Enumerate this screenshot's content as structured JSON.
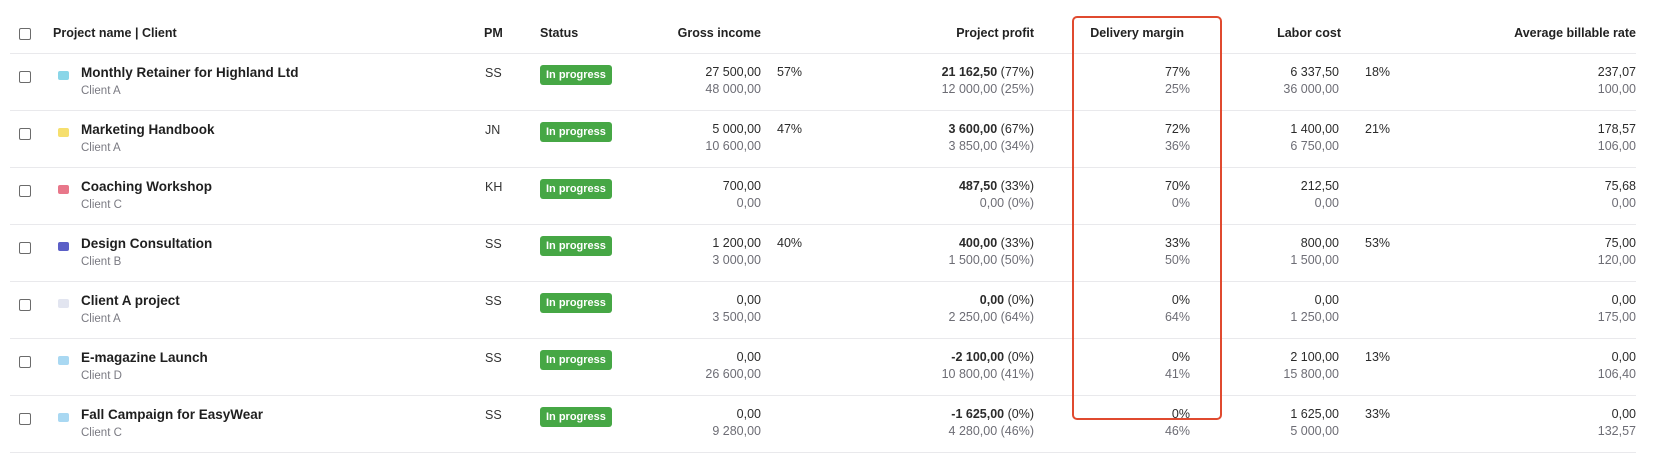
{
  "columns": {
    "project": "Project name | Client",
    "pm": "PM",
    "status": "Status",
    "gross": "Gross income",
    "profit": "Project profit",
    "delivery": "Delivery margin",
    "labor": "Labor cost",
    "rate": "Average billable rate"
  },
  "colors": {
    "status_green": "#46a745",
    "highlight": "#e04a2f"
  },
  "rows": [
    {
      "name": "Monthly Retainer for Highland Ltd",
      "client": "Client A",
      "icon": "rotate-icon",
      "icon_color": "#8ad6e8",
      "pm": "SS",
      "status": "In progress",
      "gross1": "27 500,00",
      "gross2": "48 000,00",
      "gross_pct": "57%",
      "profit1": "21 162,50",
      "profit1_pct": "(77%)",
      "profit2": "12 000,00 (25%)",
      "delivery1": "77%",
      "delivery2": "25%",
      "labor1": "6 337,50",
      "labor2": "36 000,00",
      "labor_pct": "18%",
      "rate1": "237,07",
      "rate2": "100,00"
    },
    {
      "name": "Marketing Handbook",
      "client": "Client A",
      "icon": "folder-icon",
      "icon_color": "#f6df6e",
      "pm": "JN",
      "status": "In progress",
      "gross1": "5 000,00",
      "gross2": "10 600,00",
      "gross_pct": "47%",
      "profit1": "3 600,00",
      "profit1_pct": "(67%)",
      "profit2": "3 850,00 (34%)",
      "delivery1": "72%",
      "delivery2": "36%",
      "labor1": "1 400,00",
      "labor2": "6 750,00",
      "labor_pct": "21%",
      "rate1": "178,57",
      "rate2": "106,00"
    },
    {
      "name": "Coaching Workshop",
      "client": "Client C",
      "icon": "briefcase-icon",
      "icon_color": "#e8778a",
      "pm": "KH",
      "status": "In progress",
      "gross1": "700,00",
      "gross2": "0,00",
      "gross_pct": "",
      "profit1": "487,50",
      "profit1_pct": "(33%)",
      "profit2": "0,00 (0%)",
      "delivery1": "70%",
      "delivery2": "0%",
      "labor1": "212,50",
      "labor2": "0,00",
      "labor_pct": "",
      "rate1": "75,68",
      "rate2": "0,00"
    },
    {
      "name": "Design Consultation",
      "client": "Client B",
      "icon": "briefcase-icon",
      "icon_color": "#5b5fc7",
      "pm": "SS",
      "status": "In progress",
      "gross1": "1 200,00",
      "gross2": "3 000,00",
      "gross_pct": "40%",
      "profit1": "400,00",
      "profit1_pct": "(33%)",
      "profit2": "1 500,00 (50%)",
      "delivery1": "33%",
      "delivery2": "50%",
      "labor1": "800,00",
      "labor2": "1 500,00",
      "labor_pct": "53%",
      "rate1": "75,00",
      "rate2": "120,00"
    },
    {
      "name": "Client A project",
      "client": "Client A",
      "icon": "briefcase-icon",
      "icon_color": "#e2e5f0",
      "pm": "SS",
      "status": "In progress",
      "gross1": "0,00",
      "gross2": "3 500,00",
      "gross_pct": "",
      "profit1": "0,00",
      "profit1_pct": "(0%)",
      "profit2": "2 250,00 (64%)",
      "delivery1": "0%",
      "delivery2": "64%",
      "labor1": "0,00",
      "labor2": "1 250,00",
      "labor_pct": "",
      "rate1": "0,00",
      "rate2": "175,00"
    },
    {
      "name": "E-magazine Launch",
      "client": "Client D",
      "icon": "briefcase-icon",
      "icon_color": "#a9d8f2",
      "pm": "SS",
      "status": "In progress",
      "gross1": "0,00",
      "gross2": "26 600,00",
      "gross_pct": "",
      "profit1": "-2 100,00",
      "profit1_pct": "(0%)",
      "profit2": "10 800,00 (41%)",
      "delivery1": "0%",
      "delivery2": "41%",
      "labor1": "2 100,00",
      "labor2": "15 800,00",
      "labor_pct": "13%",
      "rate1": "0,00",
      "rate2": "106,40"
    },
    {
      "name": "Fall Campaign for EasyWear",
      "client": "Client C",
      "icon": "briefcase-icon",
      "icon_color": "#a9d8f2",
      "pm": "SS",
      "status": "In progress",
      "gross1": "0,00",
      "gross2": "9 280,00",
      "gross_pct": "",
      "profit1": "-1 625,00",
      "profit1_pct": "(0%)",
      "profit2": "4 280,00 (46%)",
      "delivery1": "0%",
      "delivery2": "46%",
      "labor1": "1 625,00",
      "labor2": "5 000,00",
      "labor_pct": "33%",
      "rate1": "0,00",
      "rate2": "132,57"
    }
  ]
}
